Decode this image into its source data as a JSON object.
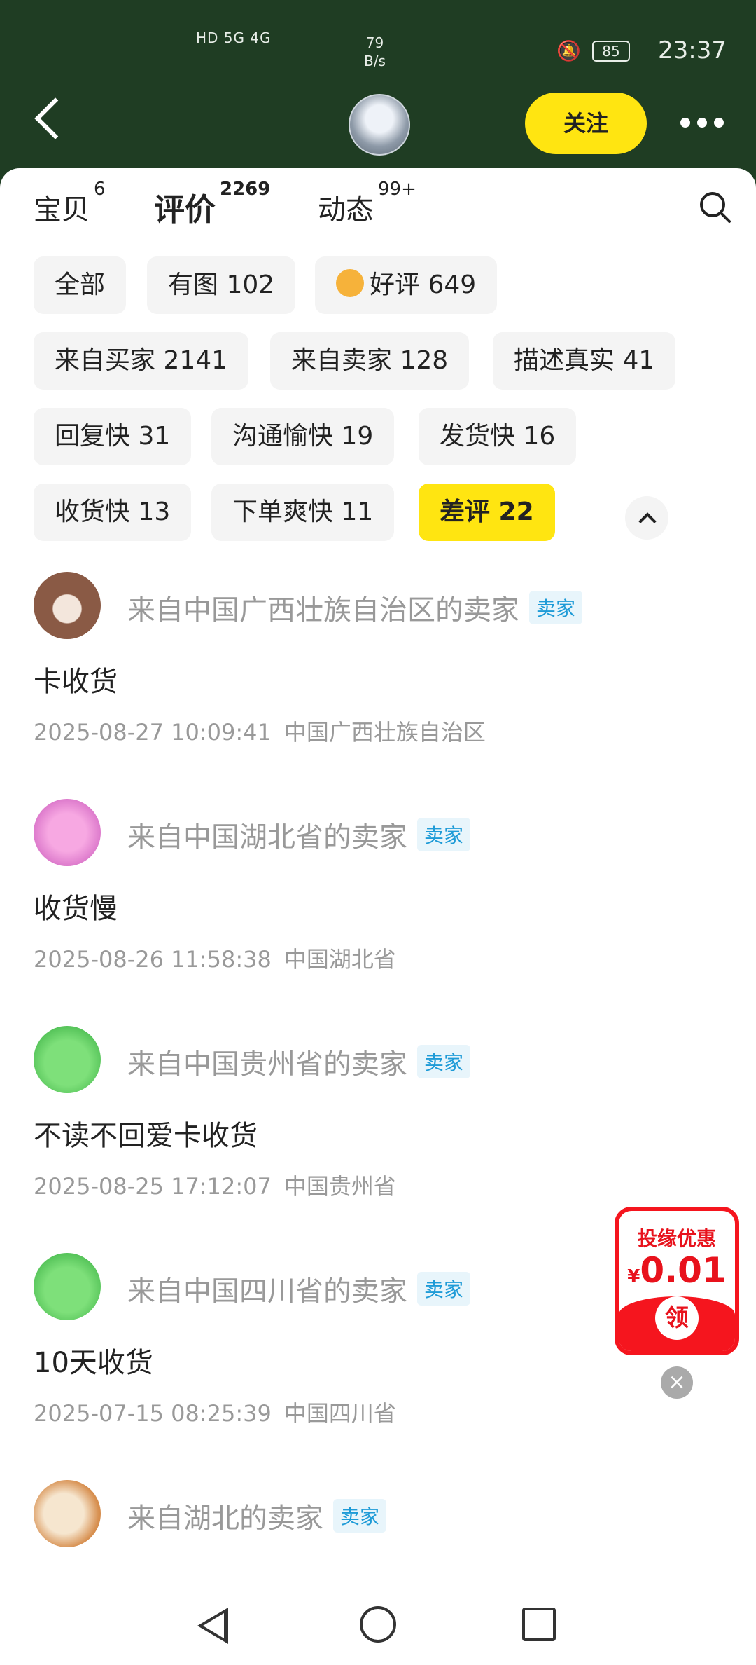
{
  "status_bar": {
    "network": "HD 5G 4G",
    "speed_value": "79",
    "speed_unit": "B/s",
    "battery": "85",
    "time": "23:37"
  },
  "header": {
    "follow_label": "关注"
  },
  "tabs": [
    {
      "label": "宝贝",
      "count": "6"
    },
    {
      "label": "评价",
      "count": "2269"
    },
    {
      "label": "动态",
      "count": "99+"
    }
  ],
  "filters": [
    {
      "label": "全部"
    },
    {
      "label": "有图 102"
    },
    {
      "label": "好评 649"
    },
    {
      "label": "来自买家 2141"
    },
    {
      "label": "来自卖家 128"
    },
    {
      "label": "描述真实 41"
    },
    {
      "label": "回复快 31"
    },
    {
      "label": "沟通愉快 19"
    },
    {
      "label": "发货快 16"
    },
    {
      "label": "收货快 13"
    },
    {
      "label": "下单爽快 11"
    },
    {
      "label": "差评 22"
    }
  ],
  "reviews": [
    {
      "from": "来自中国广西壮族自治区的卖家",
      "badge": "卖家",
      "content": "卡收货",
      "time": "2025-08-27 10:09:41",
      "location": "中国广西壮族自治区"
    },
    {
      "from": "来自中国湖北省的卖家",
      "badge": "卖家",
      "content": "收货慢",
      "time": "2025-08-26 11:58:38",
      "location": "中国湖北省"
    },
    {
      "from": "来自中国贵州省的卖家",
      "badge": "卖家",
      "content": "不读不回爱卡收货",
      "time": "2025-08-25 17:12:07",
      "location": "中国贵州省"
    },
    {
      "from": "来自中国四川省的卖家",
      "badge": "卖家",
      "content": "10天收货",
      "time": "2025-07-15 08:25:39",
      "location": "中国四川省"
    },
    {
      "from": "来自湖北的卖家",
      "badge": "卖家",
      "content": "",
      "time": "",
      "location": ""
    }
  ],
  "promo": {
    "title": "投缘优惠",
    "currency": "¥",
    "amount": "0.01",
    "button": "领"
  },
  "colors": {
    "header_bg": "#1f3d23",
    "accent": "#ffe511",
    "badge_text": "#1e9bd7",
    "promo_red": "#f5151e"
  }
}
